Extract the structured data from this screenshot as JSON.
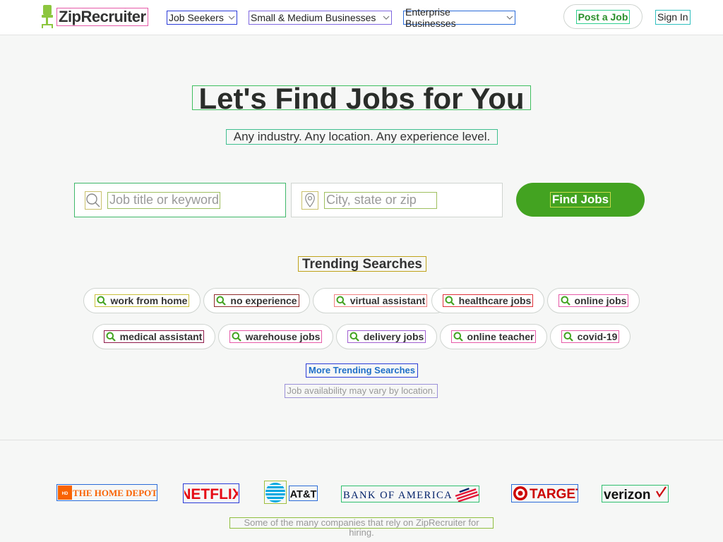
{
  "header": {
    "logo_text": "ZipRecruiter",
    "nav": [
      {
        "label": "Job Seekers"
      },
      {
        "label": "Small & Medium Businesses"
      },
      {
        "label": "Enterprise Businesses"
      }
    ],
    "post_job_label": "Post a Job",
    "sign_in_label": "Sign In"
  },
  "hero": {
    "title": "Let's Find Jobs for You",
    "subtitle": "Any industry. Any location. Any experience level."
  },
  "search": {
    "keyword_placeholder": "Job title or keyword",
    "location_placeholder": "City, state or zip",
    "button_label": "Find Jobs"
  },
  "trending": {
    "title": "Trending Searches",
    "chips": [
      "work from home",
      "no experience",
      "virtual assistant",
      "healthcare jobs",
      "online jobs",
      "medical assistant",
      "warehouse jobs",
      "delivery jobs",
      "online teacher",
      "covid-19"
    ],
    "more_label": "More Trending Searches",
    "availability_note": "Job availability may vary by location."
  },
  "companies": {
    "logos": [
      "THE HOME DEPOT",
      "NETFLIX",
      "AT&T",
      "BANK OF AMERICA",
      "TARGET",
      "verizon"
    ],
    "note": "Some of the many companies that rely on ZipRecruiter for hiring."
  },
  "colors": {
    "brand_green": "#43a321",
    "link_blue": "#1e6fc8",
    "netflix_red": "#e50914",
    "target_red": "#cc0000",
    "att_blue": "#00a8e0",
    "boa_blue": "#012169",
    "home_depot_orange": "#f96302"
  }
}
